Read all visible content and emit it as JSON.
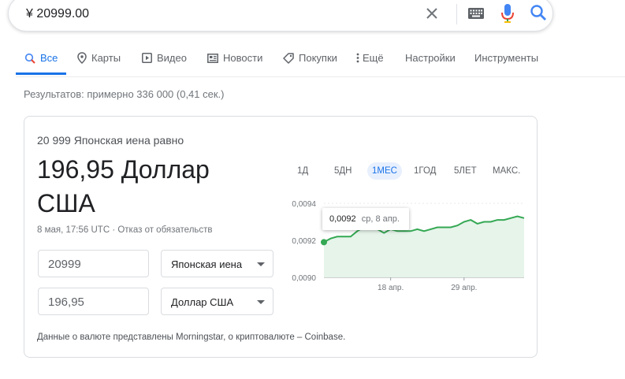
{
  "search": {
    "query": "¥ 20999.00"
  },
  "tabs": [
    {
      "label": "Все"
    },
    {
      "label": "Карты"
    },
    {
      "label": "Видео"
    },
    {
      "label": "Новости"
    },
    {
      "label": "Покупки"
    },
    {
      "label": "Ещё"
    },
    {
      "label": "Настройки"
    },
    {
      "label": "Инструменты"
    }
  ],
  "stats": "Результатов: примерно 336 000 (0,41 сек.)",
  "converter": {
    "equals_label": "20 999 Японская иена равно",
    "result_value": "196,95 Доллар",
    "result_currency": "США",
    "meta": "8 мая, 17:56 UTC · Отказ от обязательств",
    "from_amount": "20999",
    "from_currency": "Японская иена",
    "to_amount": "196,95",
    "to_currency": "Доллар США",
    "disclaimer": "Данные о валюте представлены Morningstar, о криптовалюте – Coinbase."
  },
  "ranges": [
    "1Д",
    "5ДН",
    "1МЕС",
    "1ГОД",
    "5ЛЕТ",
    "МАКС."
  ],
  "active_range": "1МЕС",
  "tooltip": {
    "value": "0,0092",
    "date": "ср, 8 апр."
  },
  "colors": {
    "accent": "#1a73e8",
    "line": "#34a853",
    "fill": "#e6f4ea"
  },
  "chart_data": {
    "type": "area",
    "y_ticks": [
      "0,0094",
      "0,0092",
      "0,0090"
    ],
    "x_ticks": [
      "18 апр.",
      "29 апр."
    ],
    "ylim": [
      0.009,
      0.0094
    ],
    "x": [
      "8 апр.",
      "9 апр.",
      "10 апр.",
      "11 апр.",
      "12 апр.",
      "13 апр.",
      "14 апр.",
      "15 апр.",
      "16 апр.",
      "17 апр.",
      "18 апр.",
      "19 апр.",
      "20 апр.",
      "21 апр.",
      "22 апр.",
      "23 апр.",
      "24 апр.",
      "25 апр.",
      "26 апр.",
      "27 апр.",
      "28 апр.",
      "29 апр.",
      "30 апр.",
      "1 мая",
      "2 мая",
      "3 мая",
      "4 мая",
      "5 мая",
      "6 мая",
      "7 мая",
      "8 мая"
    ],
    "values": [
      0.00919,
      0.00921,
      0.00922,
      0.00922,
      0.00922,
      0.00925,
      0.00927,
      0.00927,
      0.00926,
      0.00924,
      0.00926,
      0.00925,
      0.00925,
      0.00925,
      0.00926,
      0.00925,
      0.00926,
      0.00927,
      0.00927,
      0.00927,
      0.00928,
      0.0093,
      0.00931,
      0.00929,
      0.0093,
      0.0093,
      0.00931,
      0.00931,
      0.00932,
      0.00933,
      0.00932
    ]
  }
}
